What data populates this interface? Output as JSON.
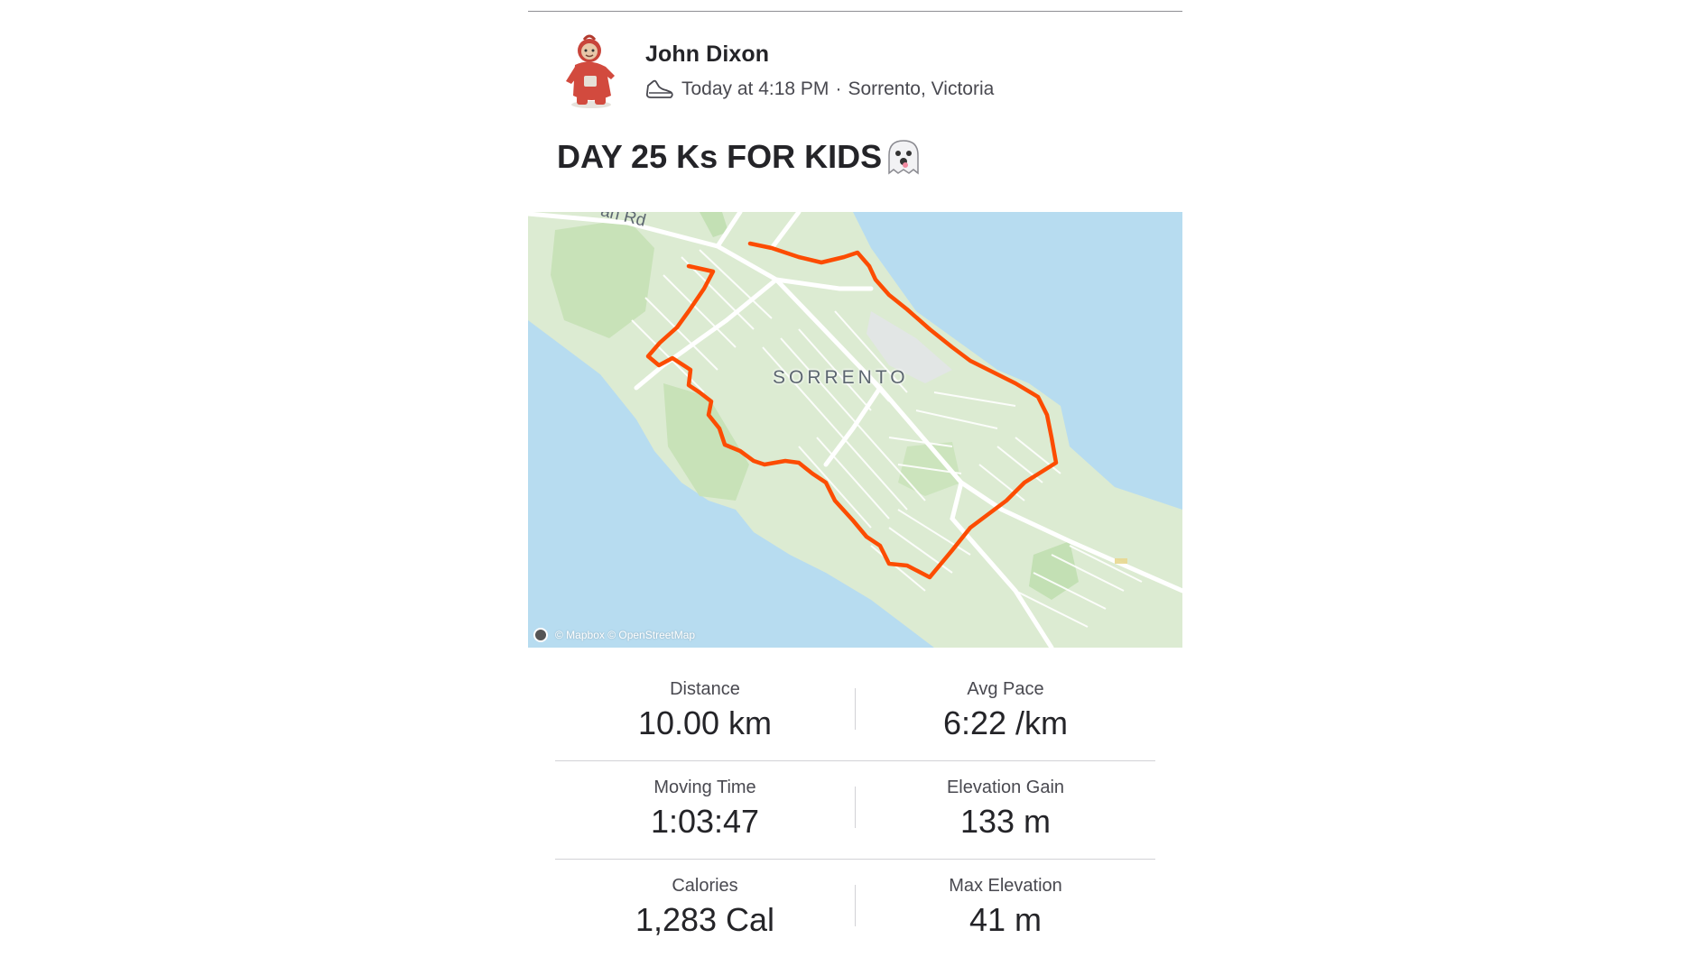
{
  "athlete": {
    "name": "John Dixon",
    "avatar": "teletubby-po-avatar"
  },
  "activity": {
    "sport_icon": "shoe-icon",
    "timestamp": "Today at 4:18 PM",
    "separator": "·",
    "location": "Sorrento, Victoria",
    "title": "DAY 25 Ks FOR KIDS",
    "title_emoji": "ghost-icon"
  },
  "map": {
    "place_label": "SORRENTO",
    "road_label": "an Rd",
    "attribution": "© Mapbox © OpenStreetMap",
    "colors": {
      "water": "#b7dcf0",
      "land": "#dcebd2",
      "park": "#c3e0b4",
      "road": "#ffffff",
      "route": "#fc4c02"
    }
  },
  "stats": {
    "distance": {
      "label": "Distance",
      "value": "10.00 km"
    },
    "avg_pace": {
      "label": "Avg Pace",
      "value": "6:22 /km"
    },
    "moving_time": {
      "label": "Moving Time",
      "value": "1:03:47"
    },
    "elevation_gain": {
      "label": "Elevation Gain",
      "value": "133 m"
    },
    "calories": {
      "label": "Calories",
      "value": "1,283 Cal"
    },
    "max_elevation": {
      "label": "Max Elevation",
      "value": "41 m"
    }
  }
}
